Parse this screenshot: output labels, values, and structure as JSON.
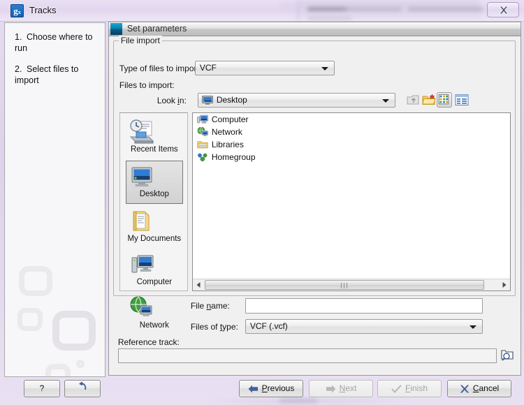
{
  "window": {
    "title": "Tracks",
    "app_icon": "workbench-g-icon",
    "close_label": "X"
  },
  "sidebar": {
    "steps": [
      {
        "num": "1.",
        "label": "Choose where to run"
      },
      {
        "num": "2.",
        "label": "Select files to import"
      }
    ]
  },
  "params_panel": {
    "header": "Set parameters",
    "group_legend": "File import",
    "type_label": "Type of files to import:",
    "type_value": "VCF",
    "files_label": "Files to import:",
    "lookin_label_pre": "Look ",
    "lookin_label_mn": "i",
    "lookin_label_post": "n:",
    "lookin_value": "Desktop",
    "toolbar": [
      {
        "name": "up-folder-icon",
        "tooltip": "Up One Level",
        "enabled": "false"
      },
      {
        "name": "new-folder-icon",
        "tooltip": "Create New Folder",
        "enabled": "true"
      },
      {
        "name": "list-view-icon",
        "tooltip": "List",
        "enabled": "true"
      },
      {
        "name": "details-view-icon",
        "tooltip": "Details",
        "enabled": "true"
      }
    ],
    "shortcuts": [
      {
        "name": "Recent Items",
        "icon": "recent-items-icon",
        "selected": "false"
      },
      {
        "name": "Desktop",
        "icon": "desktop-icon",
        "selected": "true"
      },
      {
        "name": "My Documents",
        "icon": "my-documents-icon",
        "selected": "false"
      },
      {
        "name": "Computer",
        "icon": "computer-icon",
        "selected": "false"
      },
      {
        "name": "Network",
        "icon": "network-icon",
        "selected": "false"
      }
    ],
    "files": [
      {
        "name": "Computer",
        "icon": "computer-icon"
      },
      {
        "name": "Network",
        "icon": "network-icon"
      },
      {
        "name": "Libraries",
        "icon": "libraries-folder-icon"
      },
      {
        "name": "Homegroup",
        "icon": "homegroup-icon"
      }
    ],
    "filename_label_pre": "File ",
    "filename_label_mn": "n",
    "filename_label_post": "ame:",
    "filename_value": "",
    "filetype_label_pre": "Files of ",
    "filetype_label_mn": "t",
    "filetype_label_post": "ype:",
    "filetype_value": "VCF (.vcf)",
    "reference_label": "Reference track:",
    "reference_value": "",
    "reference_browse_icon": "browse-folder-search-icon"
  },
  "buttons": {
    "help": "?",
    "undo_icon": "reset-arrow-icon",
    "previous_pre": "",
    "previous_mn": "P",
    "previous_post": "revious",
    "next_pre": "",
    "next_mn": "N",
    "next_post": "ext",
    "finish_pre": "",
    "finish_mn": "F",
    "finish_post": "inish",
    "cancel_pre": "",
    "cancel_mn": "C",
    "cancel_post": "ancel",
    "next_enabled": "false",
    "finish_enabled": "false"
  },
  "colors": {
    "titlebar": "#e4daf0",
    "accent_blue": "#1560b0",
    "header_teal": "#0a7fb5",
    "panel_bg": "#f0f0f0"
  }
}
